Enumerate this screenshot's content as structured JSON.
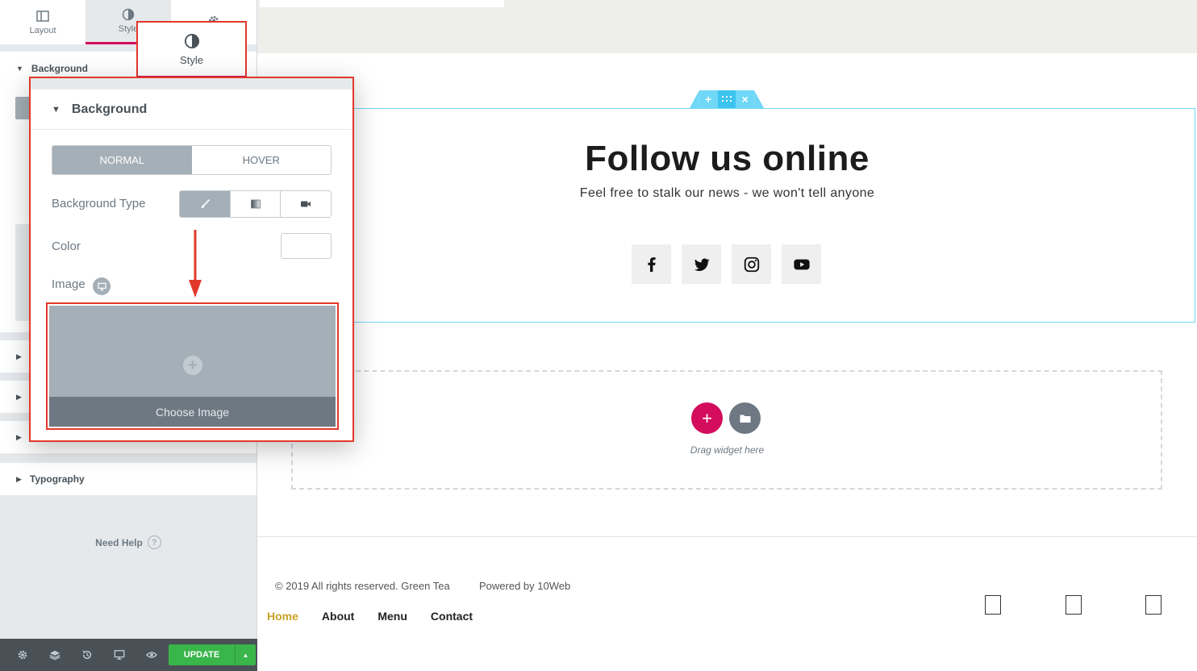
{
  "panel": {
    "tabs": [
      {
        "label": "Layout",
        "icon": "layout-icon"
      },
      {
        "label": "Style",
        "icon": "style-icon"
      },
      {
        "label": "",
        "icon": "gear-icon"
      }
    ],
    "sections": {
      "background": "Background",
      "typography": "Typography"
    },
    "need_help": "Need Help",
    "footer": {
      "update_label": "UPDATE"
    }
  },
  "zoom": {
    "style_tab_label": "Style",
    "section_title": "Background",
    "state_tabs": [
      "NORMAL",
      "HOVER"
    ],
    "background_type_label": "Background Type",
    "color_label": "Color",
    "image_label": "Image",
    "choose_image_label": "Choose Image"
  },
  "canvas": {
    "headline": "Follow us online",
    "subline": "Feel free to stalk our news - we won't tell anyone",
    "socials": [
      "facebook-icon",
      "twitter-icon",
      "instagram-icon",
      "youtube-icon"
    ],
    "drag_hint": "Drag widget here",
    "footer": {
      "copyright": "© 2019 All rights reserved. Green Tea",
      "powered": "Powered by 10Web",
      "nav": [
        "Home",
        "About",
        "Menu",
        "Contact"
      ]
    }
  },
  "colors": {
    "accent": "#d30c5c",
    "highlight": "#e2382a",
    "section_outline": "#71d7f7",
    "update_green": "#39b54a",
    "active_nav": "#c9a227"
  }
}
